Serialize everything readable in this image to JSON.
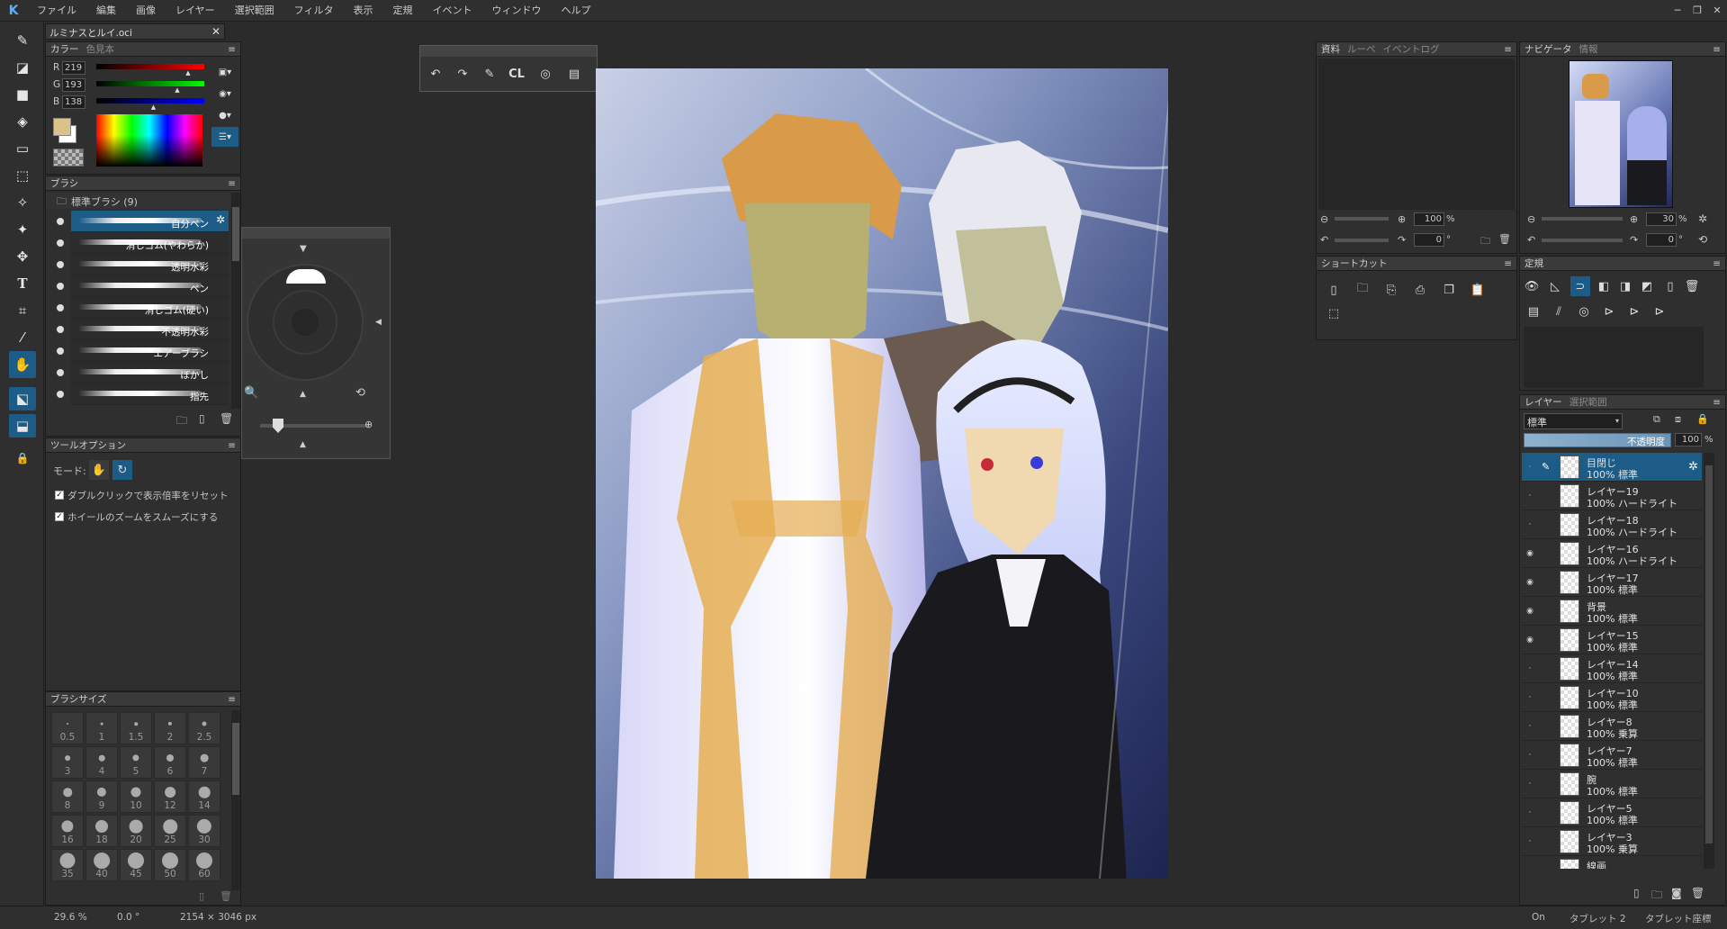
{
  "app": {
    "logo": "K",
    "menu": [
      "ファイル",
      "編集",
      "画像",
      "レイヤー",
      "選択範囲",
      "フィルタ",
      "表示",
      "定規",
      "イベント",
      "ウィンドウ",
      "ヘルプ"
    ],
    "window_controls": [
      "─",
      "❐",
      "✕"
    ]
  },
  "document_tab": {
    "title": "ルミナスとルイ.oci",
    "close": "✕"
  },
  "color_panel": {
    "tabs": [
      "カラー",
      "色見本"
    ],
    "r_label": "R",
    "g_label": "G",
    "b_label": "B",
    "r": "219",
    "g": "193",
    "b": "138",
    "r_fraction": 0.86,
    "g_fraction": 0.76,
    "b_fraction": 0.54,
    "primary_color": "#dbc18a",
    "secondary_color": "#ffffff"
  },
  "brush_panel": {
    "title": "ブラシ",
    "group": "標準ブラシ (9)",
    "items": [
      "自分ペン",
      "消しゴム(やわらか)",
      "透明水彩",
      "ペン",
      "消しゴム(硬い)",
      "不透明水彩",
      "エアーブラシ",
      "ぼかし",
      "指先"
    ]
  },
  "tool_option": {
    "title": "ツールオプション",
    "mode_label": "モード:",
    "check1": "ダブルクリックで表示倍率をリセット",
    "check2": "ホイールのズームをスムーズにする",
    "check_mark": "✓"
  },
  "brush_size": {
    "title": "ブラシサイズ",
    "sizes": [
      "0.5",
      "1",
      "1.5",
      "2",
      "2.5",
      "3",
      "4",
      "5",
      "6",
      "7",
      "8",
      "9",
      "10",
      "12",
      "14",
      "16",
      "18",
      "20",
      "25",
      "30",
      "35",
      "40",
      "45",
      "50",
      "60"
    ]
  },
  "floating_toolbar": {
    "cl_label": "CL"
  },
  "material_panel": {
    "tabs": [
      "資料",
      "ルーペ",
      "イベントログ"
    ],
    "zoom": "100",
    "zoom_unit": "%",
    "angle": "0",
    "angle_unit": "°"
  },
  "navigator": {
    "tabs": [
      "ナビゲータ",
      "情報"
    ],
    "zoom": "30",
    "zoom_unit": "%",
    "angle": "0",
    "angle_unit": "°"
  },
  "shortcut_panel": {
    "title": "ショートカット"
  },
  "ruler_panel": {
    "title": "定規"
  },
  "layer_panel": {
    "tabs": [
      "レイヤー",
      "選択範囲"
    ],
    "blend_mode": "標準",
    "opacity_label": "不透明度",
    "opacity": "100",
    "opacity_unit": "%",
    "layers": [
      {
        "name": "目閉じ",
        "mode": "100% 標準",
        "visible": false,
        "selected": true
      },
      {
        "name": "レイヤー19",
        "mode": "100% ハードライト",
        "visible": false
      },
      {
        "name": "レイヤー18",
        "mode": "100% ハードライト",
        "visible": false
      },
      {
        "name": "レイヤー16",
        "mode": "100% ハードライト",
        "visible": true
      },
      {
        "name": "レイヤー17",
        "mode": "100% 標準",
        "visible": true
      },
      {
        "name": "背景",
        "mode": "100% 標準",
        "visible": true
      },
      {
        "name": "レイヤー15",
        "mode": "100% 標準",
        "visible": true
      },
      {
        "name": "レイヤー14",
        "mode": "100% 標準",
        "visible": false
      },
      {
        "name": "レイヤー10",
        "mode": "100% 標準",
        "visible": false
      },
      {
        "name": "レイヤー8",
        "mode": "100% 乗算",
        "visible": false
      },
      {
        "name": "レイヤー7",
        "mode": "100% 標準",
        "visible": false
      },
      {
        "name": "腕",
        "mode": "100% 標準",
        "visible": false
      },
      {
        "name": "レイヤー5",
        "mode": "100% 標準",
        "visible": false
      },
      {
        "name": "レイヤー3",
        "mode": "100% 乗算",
        "visible": false
      },
      {
        "name": "線画",
        "mode": "",
        "visible": false
      }
    ]
  },
  "status": {
    "zoom": "29.6 %",
    "angle": "0.0 °",
    "size": "2154 × 3046 px",
    "on": "On",
    "tablet": "タブレット 2",
    "tablet_coord": "タブレット座標"
  }
}
